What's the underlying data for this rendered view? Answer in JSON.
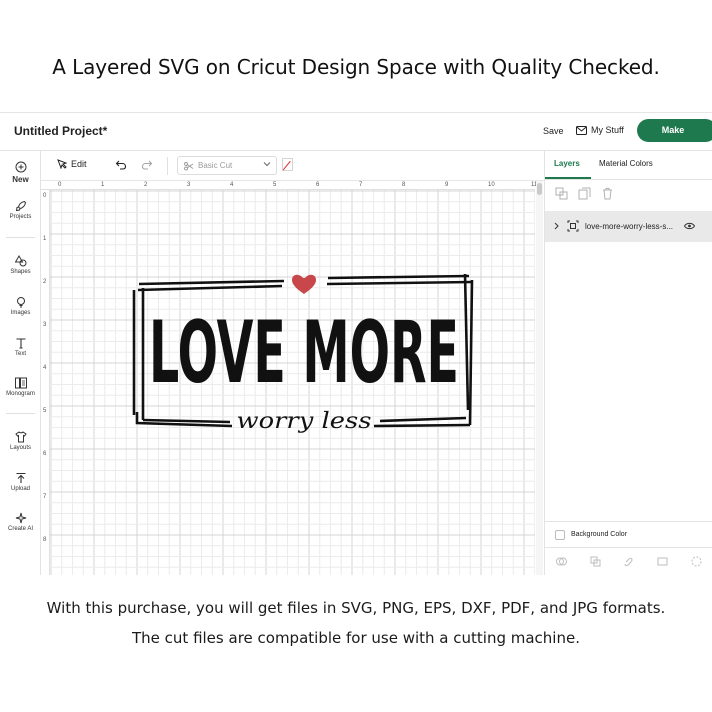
{
  "headline": "A Layered SVG on Cricut Design Space with Quality Checked.",
  "topbar": {
    "project_title": "Untitled Project*",
    "save": "Save",
    "my_stuff": "My Stuff",
    "make": "Make"
  },
  "sidebar": {
    "items": [
      {
        "label": "New",
        "icon": "plus-circle-icon"
      },
      {
        "label": "Projects",
        "icon": "rocket-icon"
      },
      {
        "label": "Shapes",
        "icon": "shapes-icon"
      },
      {
        "label": "Images",
        "icon": "lightbulb-icon"
      },
      {
        "label": "Text",
        "icon": "text-icon"
      },
      {
        "label": "Monogram",
        "icon": "monogram-icon"
      },
      {
        "label": "Layouts",
        "icon": "shirt-icon"
      },
      {
        "label": "Upload",
        "icon": "upload-icon"
      },
      {
        "label": "Create AI",
        "icon": "sparkle-icon"
      }
    ]
  },
  "toolbar": {
    "edit": "Edit",
    "operation": "Basic Cut"
  },
  "rulers": {
    "top": [
      "0",
      "1",
      "2",
      "3",
      "4",
      "5",
      "6",
      "7",
      "8",
      "9",
      "10",
      "11"
    ],
    "left": [
      "0",
      "1",
      "2",
      "3",
      "4",
      "5",
      "6",
      "7",
      "8"
    ]
  },
  "design": {
    "main_text": "LOVE MORE",
    "sub_text": "worry less",
    "heart_color": "#c8474b",
    "ink_color": "#111111"
  },
  "right_panel": {
    "tabs": [
      "Layers",
      "Material Colors"
    ],
    "active_tab": "Layers",
    "layer_name": "love-more-worry-less-s...",
    "background_color_label": "Background Color"
  },
  "colors": {
    "accent": "#1e7a4e",
    "layer_row_bg": "#e9e9e9"
  },
  "footer": {
    "line1": "With this purchase, you will get files in SVG, PNG, EPS, DXF, PDF, and JPG formats.",
    "line2": "The cut files are compatible for use with a cutting machine."
  }
}
